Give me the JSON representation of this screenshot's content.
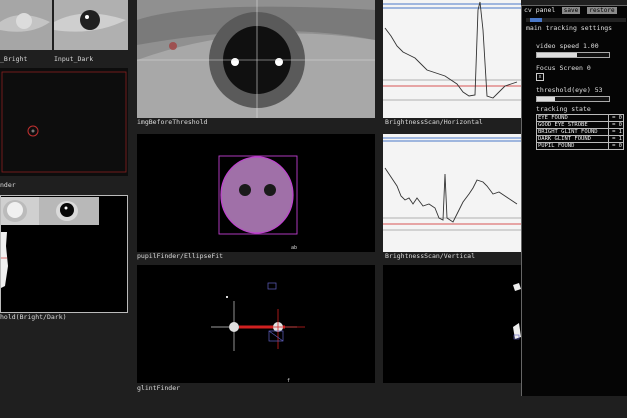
{
  "labels": {
    "input_bright": "_Bright",
    "input_dark": "Input_Dark",
    "img_before_threshold": "imgBeforeThreshold",
    "brightness_horizontal": "BrightnessScan/Horizontal",
    "pupil_finder": "nder",
    "pupil_ellipse": "pupilFinder/EllipseFit",
    "brightness_vertical": "BrightnessScan/Vertical",
    "threshold_bright_dark": "hold(Bright/Dark)",
    "glint_finder": "glintFinder",
    "ellipse_small_label": "ab",
    "glint_f": "f"
  },
  "cv_panel": {
    "title": "cv panel",
    "save_label": "save",
    "restore_label": "restore",
    "tab_label": "main tracking settings",
    "video_speed": {
      "label": "video speed",
      "value": "1.00",
      "level": 0.55
    },
    "focus_screen": {
      "label": "Focus Screen",
      "value": "0",
      "checkbox_mark": "x"
    },
    "threshold_eye": {
      "label": "threshold(eye)",
      "value": "53",
      "level": 0.25
    },
    "tracking_state_label": "tracking state",
    "tracking_state": [
      {
        "name": "EYE FOUND",
        "value": "= 0"
      },
      {
        "name": "GOOD EYE STROBE",
        "value": "= 0"
      },
      {
        "name": "BRIGHT GLINT FOUND",
        "value": "= 1"
      },
      {
        "name": "DARK GLINT FOUND",
        "value": "= 1"
      },
      {
        "name": "PUPIL FOUND",
        "value": "= 0"
      }
    ]
  },
  "colors": {
    "accent_blue": "#4a78c8",
    "pupil_fill": "#a070a8",
    "pupil_edge": "#c040d0",
    "red_line": "#d02020"
  }
}
